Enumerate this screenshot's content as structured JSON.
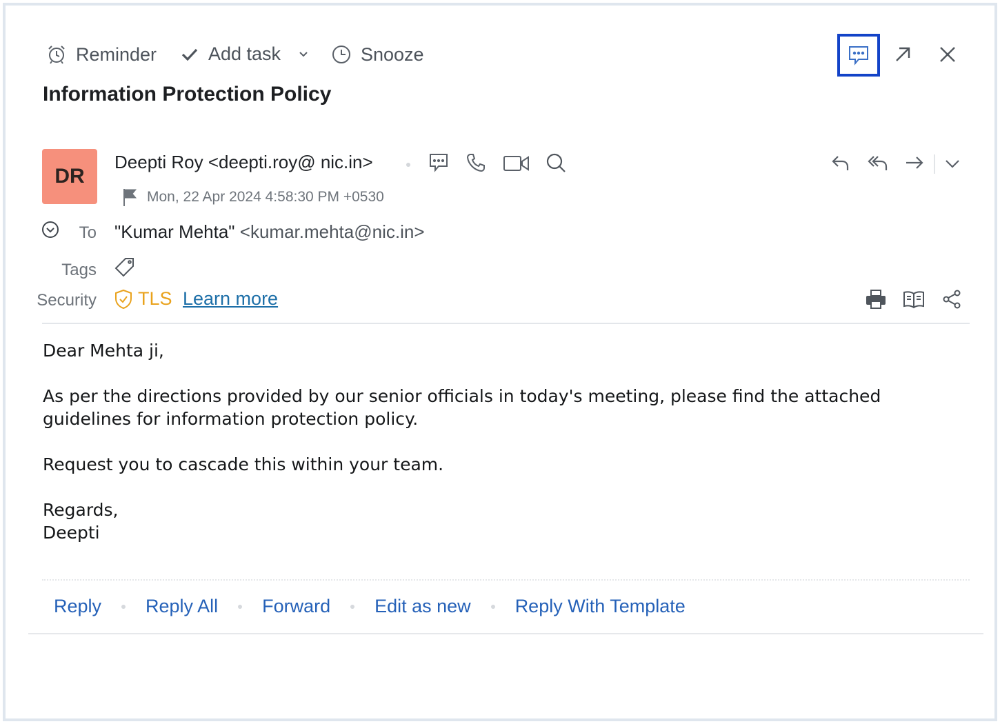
{
  "toolbar": {
    "reminder_label": "Reminder",
    "add_task_label": "Add task",
    "snooze_label": "Snooze"
  },
  "subject": "Information Protection Policy",
  "sender": {
    "initials": "DR",
    "avatar_color": "#f6907c",
    "name_email": "Deepti Roy <deepti.roy@ nic.in>",
    "date": "Mon, 22 Apr 2024 4:58:30 PM +0530"
  },
  "recipients": {
    "to_label": "To",
    "to_name": "\"Kumar Mehta\"",
    "to_email": "<kumar.mehta@nic.in>"
  },
  "tags": {
    "label": "Tags"
  },
  "security": {
    "label": "Security",
    "value": "TLS",
    "link": "Learn more",
    "color": "#e9a21c"
  },
  "body": {
    "greeting": "Dear Mehta ji,",
    "paragraph1": "As per the directions provided by our senior officials in today's meeting, please find the attached guidelines for information protection policy.",
    "paragraph2": "Request you to cascade this within your team.",
    "closing": "Regards,",
    "signature": "Deepti"
  },
  "actions": {
    "reply": "Reply",
    "reply_all": "Reply All",
    "forward": "Forward",
    "edit_as_new": "Edit as new",
    "reply_template": "Reply With Template"
  },
  "icons": {
    "reminder": "alarm-clock-icon",
    "add_task": "checkmark-icon",
    "snooze": "clock-icon",
    "chat": "chat-bubble-icon",
    "popout": "arrow-up-right-icon",
    "close": "close-icon",
    "call": "phone-icon",
    "video": "video-icon",
    "search": "search-icon",
    "flag": "flag-icon",
    "tag": "tag-icon",
    "shield": "shield-check-icon",
    "print": "printer-icon",
    "reading": "open-book-icon",
    "share": "share-icon",
    "reply": "reply-icon",
    "reply_all": "reply-all-icon",
    "forward": "forward-icon",
    "expand": "chevron-down-icon"
  },
  "colors": {
    "accent_link": "#2561b8",
    "highlight_border": "#1343c8"
  }
}
